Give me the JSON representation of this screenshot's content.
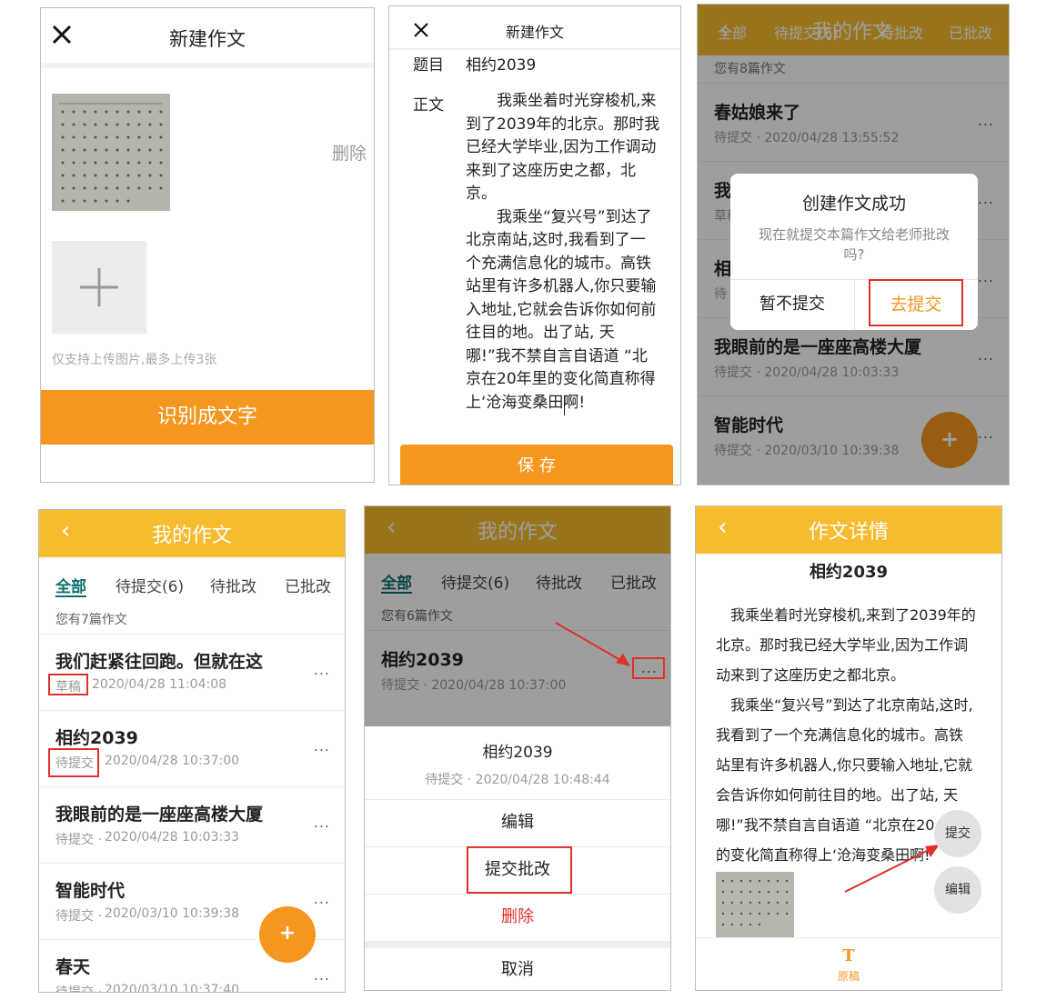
{
  "colors": {
    "orange": "#f5961e",
    "yellow": "#f6bb2e",
    "teal": "#0d6e6e",
    "red": "#e0302a",
    "gray_text": "#999999"
  },
  "p1": {
    "close_icon": "close-icon",
    "title": "新建作文",
    "delete_label": "删除",
    "add_icon": "plus-icon",
    "hint": "仅支持上传图片,最多上传3张",
    "recognize_button": "识别成文字"
  },
  "p2": {
    "close_icon": "close-icon",
    "title": "新建作文",
    "subject_label": "题目",
    "subject_value": "相约2039",
    "body_label": "正文",
    "body_lines": [
      "　　我乘坐着时光穿梭机,来",
      "到了2039年的北京。那时我",
      "已经大学毕业,因为工作调动",
      "来到了这座历史之都，北",
      "京。",
      "　　我乘坐“复兴号”到达了",
      "北京南站,这时,我看到了一",
      "个充满信息化的城市。高铁",
      "站里有许多机器人,你只要输",
      "入地址,它就会告诉你如何前",
      "往目的地。出了站, 天",
      "哪!”我不禁自言自语道 “北",
      "京在20年里的变化简直称得",
      "上‘沧海变桑田啊!"
    ],
    "save_button": "保 存"
  },
  "p3": {
    "back_icon": "chevron-left-icon",
    "title": "我的作文",
    "tabs": [
      "全部",
      "待提交(6)",
      "待批改",
      "已批改"
    ],
    "count": "您有8篇作文",
    "items": [
      {
        "title": "春姑娘来了",
        "sub": "待提交 · 2020/04/28 13:55:52"
      },
      {
        "title": "我",
        "sub": "草稿"
      },
      {
        "title": "相",
        "sub": "待"
      },
      {
        "title": "我眼前的是一座座高楼大厦",
        "sub": "待提交 · 2020/04/28 10:03:33"
      },
      {
        "title": "智能时代",
        "sub": "待提交 · 2020/03/10 10:39:38"
      }
    ],
    "more": "...",
    "fab": "+",
    "dialog": {
      "title": "创建作文成功",
      "message": "现在就提交本篇作文给老师批改吗?",
      "cancel": "暂不提交",
      "confirm": "去提交"
    }
  },
  "p4": {
    "back_icon": "chevron-left-icon",
    "title": "我的作文",
    "tabs": [
      "全部",
      "待提交(6)",
      "待批改",
      "已批改"
    ],
    "count": "您有7篇作文",
    "items": [
      {
        "title": "我们赶紧往回跑。但就在这",
        "status": "草稿",
        "date": "2020/04/28 11:04:08"
      },
      {
        "title": "相约2039",
        "status": "待提交",
        "date": "2020/04/28 10:37:00"
      },
      {
        "title": "我眼前的是一座座高楼大厦",
        "status": "待提交 ·",
        "date": "2020/04/28 10:03:33"
      },
      {
        "title": "智能时代",
        "status": "待提交 ·",
        "date": "2020/03/10 10:39:38"
      },
      {
        "title": "春天",
        "status": "待提交 ·",
        "date": "2020/03/10 10:37:40"
      }
    ],
    "more": "...",
    "fab": "+"
  },
  "p5": {
    "back_icon": "chevron-left-icon",
    "title": "我的作文",
    "tabs": [
      "全部",
      "待提交(6)",
      "待批改",
      "已批改"
    ],
    "count": "您有6篇作文",
    "item": {
      "title": "相约2039",
      "sub": "待提交 · 2020/04/28 10:37:00"
    },
    "more": "...",
    "sheet": {
      "title": "相约2039",
      "sub": "待提交 · 2020/04/28 10:48:44",
      "actions": [
        "编辑",
        "提交批改",
        "删除"
      ],
      "cancel": "取消"
    }
  },
  "p6": {
    "back_icon": "chevron-left-icon",
    "title": "作文详情",
    "essay_title": "相约2039",
    "lines": [
      "　我乘坐着时光穿梭机,来到了2039年的",
      "北京。那时我已经大学毕业,因为工作调",
      "动来到了这座历史之都北京。",
      "　我乘坐“复兴号”到达了北京南站,这时,",
      "我看到了一个充满信息化的城市。高铁",
      "站里有许多机器人,你只要输入地址,它就",
      "会告诉你如何前往目的地。出了站, 天",
      "哪!”我不禁自言自语道 “北京在20",
      "的变化简直称得上‘沧海变桑田啊!"
    ],
    "submit_button": "提交",
    "edit_button": "编辑",
    "bottom_icon": "T",
    "bottom_label": "原稿"
  }
}
